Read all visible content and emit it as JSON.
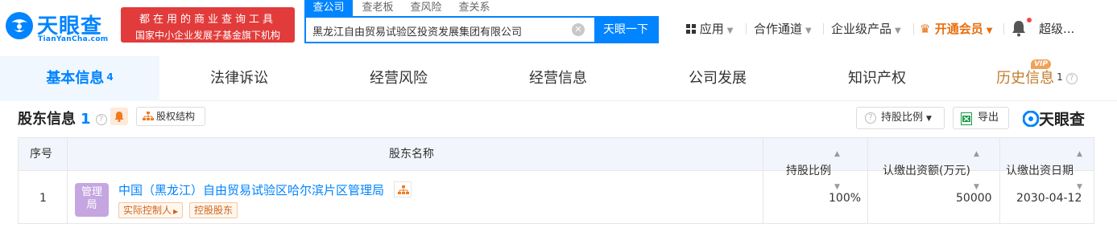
{
  "brand": {
    "name": "天眼查",
    "domain": "TianYanCha.com",
    "blue": "#0084ff"
  },
  "banner": {
    "line1": "都在用的商业查询工具",
    "line2": "国家中小企业发展子基金旗下机构",
    "color": "#e23b3b"
  },
  "search": {
    "tabs": [
      "查公司",
      "查老板",
      "查风险",
      "查关系"
    ],
    "active_tab": "查公司",
    "value": "黑龙江自由贸易试验区投资发展集团有限公司",
    "button": "天眼一下"
  },
  "nav": {
    "apps": "应用",
    "channel": "合作通道",
    "enterprise": "企业级产品",
    "vip": "开通会员",
    "user": "超级..."
  },
  "tabs": [
    {
      "label": "基本信息",
      "count": "4"
    },
    {
      "label": "法律诉讼"
    },
    {
      "label": "经营风险"
    },
    {
      "label": "经营信息"
    },
    {
      "label": "公司发展"
    },
    {
      "label": "知识产权"
    },
    {
      "label": "历史信息",
      "count": "1",
      "badge": "VIP"
    }
  ],
  "section": {
    "title": "股东信息",
    "count": "1",
    "equity_button": "股权结构",
    "ratio_button": "持股比例",
    "export_button": "导出",
    "watermark": "天眼查"
  },
  "table": {
    "headers": [
      "序号",
      "股东名称",
      "持股比例",
      "认缴出资额(万元)",
      "认缴出资日期"
    ],
    "rows": [
      {
        "index": "1",
        "avatar": "管理局",
        "name": "中国（黑龙江）自由贸易试验区哈尔滨片区管理局",
        "tags": [
          "实际控制人",
          "控股股东"
        ],
        "ratio": "100%",
        "amount": "50000",
        "date": "2030-04-12"
      }
    ]
  }
}
